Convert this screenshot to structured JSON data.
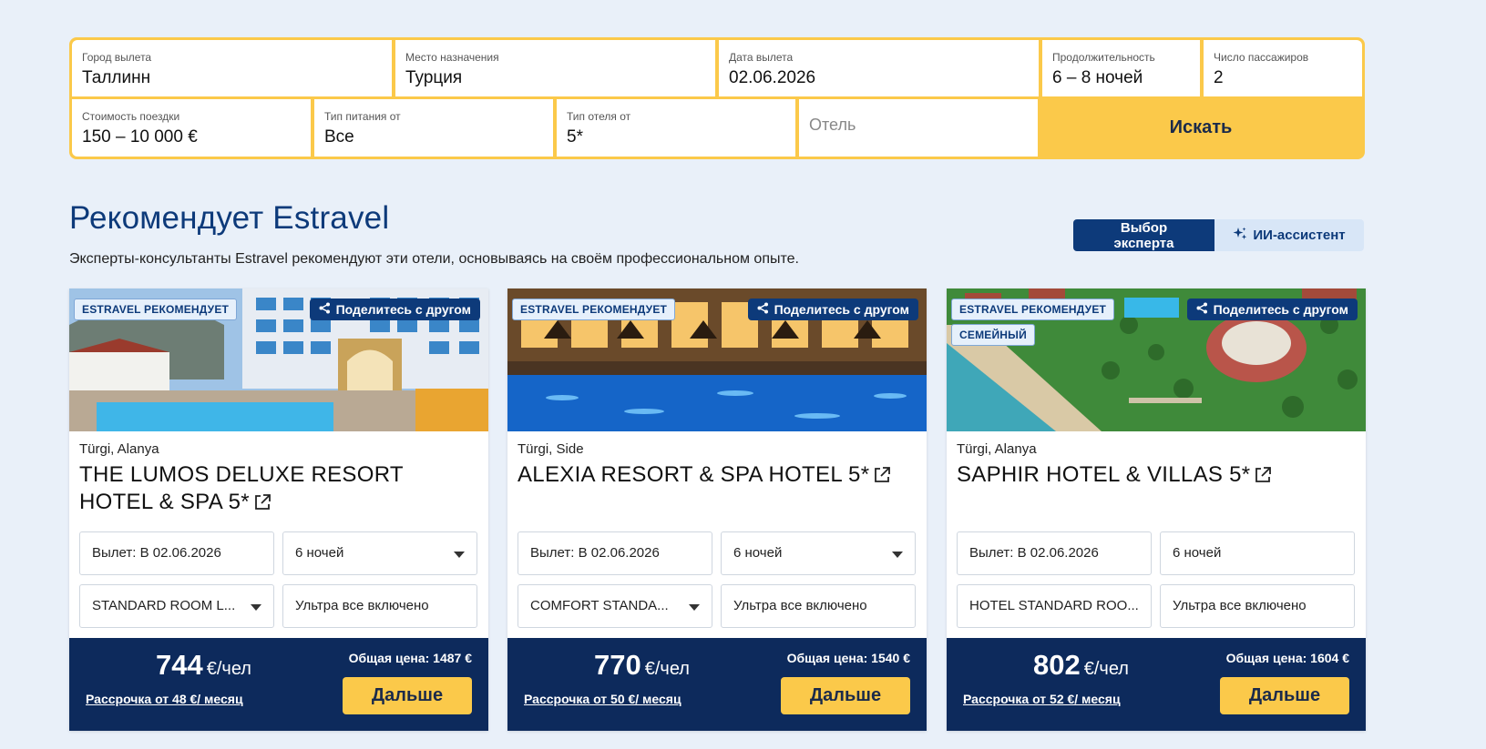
{
  "search": {
    "departure_city": {
      "label": "Город вылета",
      "value": "Таллинн"
    },
    "destination": {
      "label": "Место назначения",
      "value": "Турция"
    },
    "departure_date": {
      "label": "Дата вылета",
      "value": "02.06.2026"
    },
    "duration": {
      "label": "Продолжительность",
      "value": "6 – 8 ночей"
    },
    "passengers": {
      "label": "Число пассажиров",
      "value": "2"
    },
    "price_range": {
      "label": "Стоимость поездки",
      "value": "150 – 10 000 €"
    },
    "meal_type": {
      "label": "Тип питания от",
      "value": "Все"
    },
    "hotel_class": {
      "label": "Тип отеля от",
      "value": "5*"
    },
    "hotel": {
      "placeholder": "Отель"
    },
    "search_button": "Искать"
  },
  "section": {
    "title": "Рекомендует Estravel",
    "subtitle": "Эксперты-консультанты Estravel рекомендуют эти отели, основываясь на своём профессиональном опыте.",
    "toggle": {
      "expert": "Выбор эксперта",
      "ai": "ИИ-ассистент"
    }
  },
  "colors": {
    "brand_blue": "#0d3a7a",
    "accent_yellow": "#fbc94a",
    "price_bar": "#0d2a5c"
  },
  "cards": [
    {
      "badges": [
        "ESTRAVEL РЕКОМЕНДУЕТ"
      ],
      "share": "Поделитесь с другом",
      "location": "Türgi, Alanya",
      "name": "THE LUMOS DELUXE RESORT HOTEL & SPA 5*",
      "departure": "Вылет: В 02.06.2026",
      "nights": "6 ночей",
      "room": "STANDARD ROOM L...",
      "meal": "Ультра все включено",
      "price": "744",
      "unit": "€/чел",
      "total": "Общая цена: 1487 €",
      "installment": "Рассрочка от 48 €/ месяц",
      "next": "Дальше"
    },
    {
      "badges": [
        "ESTRAVEL РЕКОМЕНДУЕТ"
      ],
      "share": "Поделитесь с другом",
      "location": "Türgi, Side",
      "name": "ALEXIA RESORT & SPA HOTEL 5*",
      "departure": "Вылет: В 02.06.2026",
      "nights": "6 ночей",
      "room": "COMFORT STANDA...",
      "meal": "Ультра все включено",
      "price": "770",
      "unit": "€/чел",
      "total": "Общая цена: 1540 €",
      "installment": "Рассрочка от 50 €/ месяц",
      "next": "Дальше"
    },
    {
      "badges": [
        "ESTRAVEL РЕКОМЕНДУЕТ",
        "СЕМЕЙНЫЙ"
      ],
      "share": "Поделитесь с другом",
      "location": "Türgi, Alanya",
      "name": "SAPHIR HOTEL & VILLAS 5*",
      "departure": "Вылет: В 02.06.2026",
      "nights": "6 ночей",
      "room": "HOTEL STANDARD ROO...",
      "meal": "Ультра все включено",
      "price": "802",
      "unit": "€/чел",
      "total": "Общая цена: 1604 €",
      "installment": "Рассрочка от 52 €/ месяц",
      "next": "Дальше"
    }
  ]
}
